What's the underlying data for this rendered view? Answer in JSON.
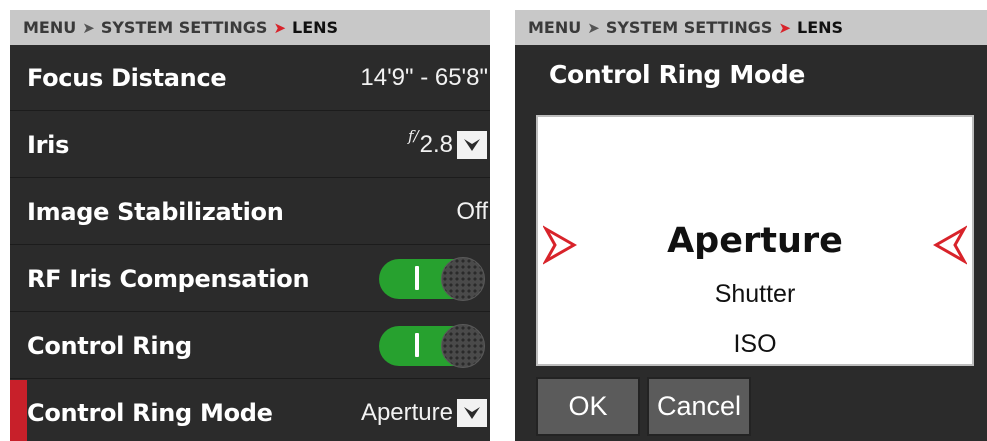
{
  "breadcrumb": {
    "root": "MENU",
    "parent": "SYSTEM SETTINGS",
    "current": "LENS",
    "sep_symbol": "➤"
  },
  "settings": {
    "focus_distance": {
      "label": "Focus Distance",
      "value": "14'9\" - 65'8\""
    },
    "iris": {
      "label": "Iris",
      "prefix": "f/",
      "value": "2.8"
    },
    "image_stabilization": {
      "label": "Image Stabilization",
      "value": "Off"
    },
    "rf_iris_compensation": {
      "label": "RF Iris Compensation",
      "enabled": true
    },
    "control_ring": {
      "label": "Control Ring",
      "enabled": true
    },
    "control_ring_mode": {
      "label": "Control Ring Mode",
      "value": "Aperture",
      "selected": true
    }
  },
  "dialog": {
    "title": "Control Ring Mode",
    "options": [
      "Aperture",
      "Shutter",
      "ISO"
    ],
    "selected_option": "Aperture",
    "ok_label": "OK",
    "cancel_label": "Cancel"
  },
  "colors": {
    "panel_bg": "#2b2b2b",
    "header_bg": "#c8c8c8",
    "accent_red": "#d8232a",
    "toggle_on": "#27a12f"
  },
  "icons": {
    "breadcrumb_sep": "chevron-right-icon",
    "dropdown": "chevron-down-icon",
    "picker_prev": "arrow-left-outline-icon",
    "picker_next": "arrow-right-outline-icon"
  }
}
